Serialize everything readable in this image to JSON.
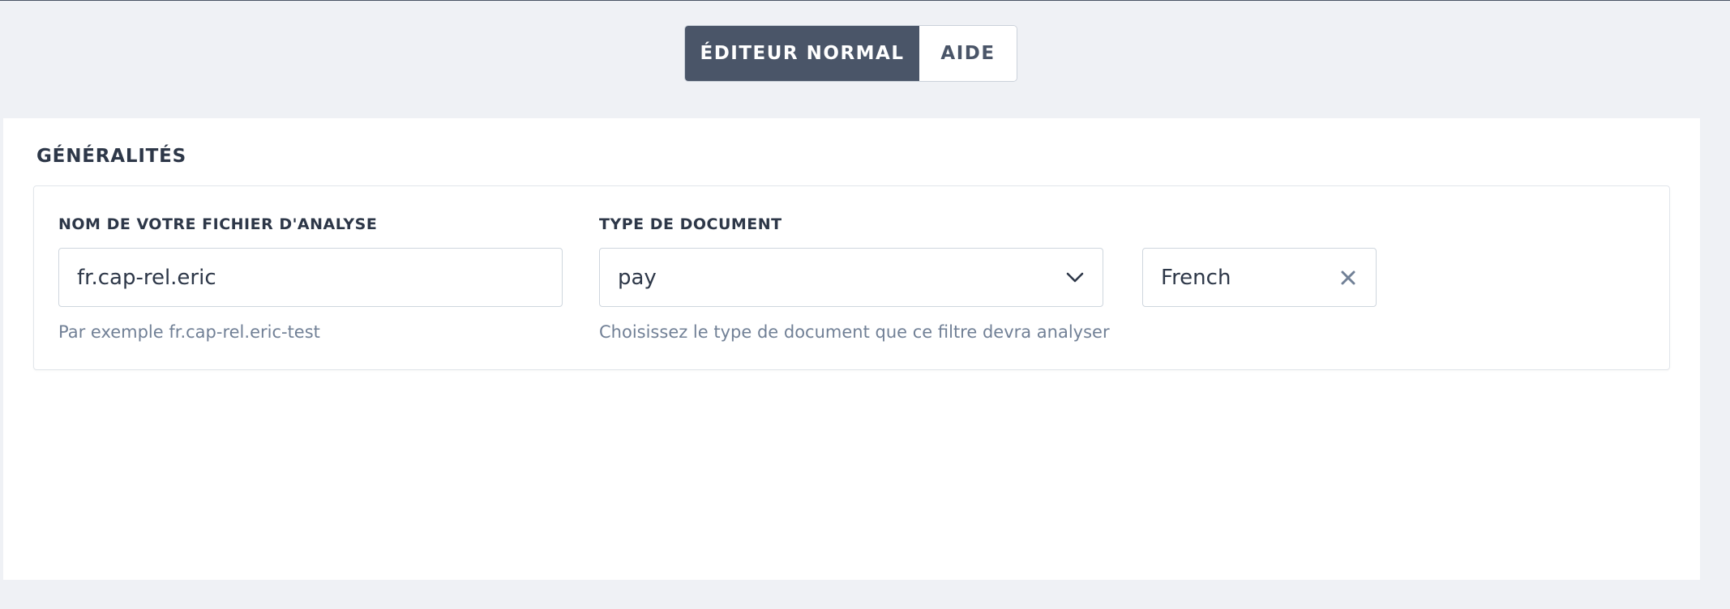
{
  "mode_toggle": {
    "active_label": "ÉDITEUR NORMAL",
    "inactive_label": "AIDE"
  },
  "section": {
    "title": "GÉNÉRALITÉS"
  },
  "fields": {
    "filename": {
      "label": "NOM DE VOTRE FICHIER D'ANALYSE",
      "value": "fr.cap-rel.eric",
      "help": "Par exemple fr.cap-rel.eric-test"
    },
    "doc_type": {
      "label": "TYPE DE DOCUMENT",
      "value": "pay",
      "help": "Choisissez le type de document que ce filtre devra analyser",
      "icon": "chevron-down-icon"
    },
    "language": {
      "value": "French",
      "icon": "close-icon"
    }
  },
  "colors": {
    "active_button_bg": "#4a5568",
    "page_bg": "#eff1f5",
    "help_text": "#718096"
  }
}
